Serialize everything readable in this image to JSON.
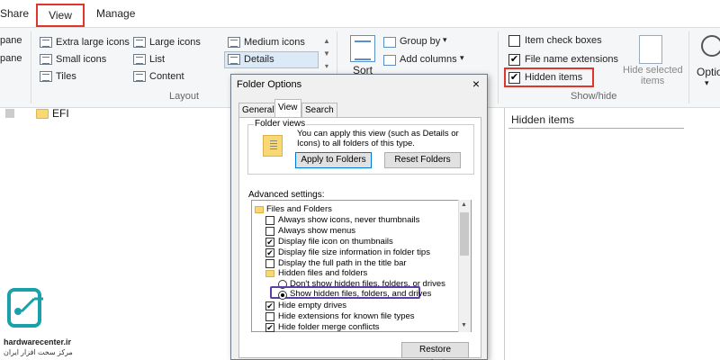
{
  "tabs": {
    "share": "Share",
    "view": "View",
    "manage": "Manage"
  },
  "ribbon": {
    "pane_1": "pane",
    "pane_2": "pane",
    "layout": {
      "extra_large_icons": "Extra large icons",
      "large_icons": "Large icons",
      "medium_icons": "Medium icons",
      "small_icons": "Small icons",
      "list": "List",
      "details": "Details",
      "tiles": "Tiles",
      "content": "Content",
      "group_label": "Layout"
    },
    "current_view": {
      "sort": "Sort",
      "group_by": "Group by",
      "add_columns": "Add columns"
    },
    "show_hide": {
      "item_check_boxes": "Item check boxes",
      "file_name_extensions": "File name extensions",
      "hidden_items": "Hidden items",
      "hide_selected_1": "Hide selected",
      "hide_selected_2": "items",
      "group_label": "Show/hide"
    },
    "options": "Optio"
  },
  "file_area": {
    "file_name": "EFI",
    "preview_title": "Hidden items"
  },
  "logo": {
    "name": "hardwarecenter.ir",
    "tagline": "مرکز سخت افزار ایران"
  },
  "dialog": {
    "title": "Folder Options",
    "close": "×",
    "tabs": [
      "General",
      "View",
      "Search"
    ],
    "folder_views_label": "Folder views",
    "folder_views_text": "You can apply this view (such as Details or Icons) to all folders of this type.",
    "apply_button": "Apply to Folders",
    "reset_button": "Reset Folders",
    "advanced_label": "Advanced settings:",
    "advanced_items": [
      "Files and Folders",
      "Always show icons, never thumbnails",
      "Always show menus",
      "Display file icon on thumbnails",
      "Display file size information in folder tips",
      "Display the full path in the title bar",
      "Hidden files and folders",
      "Don't show hidden files, folders, or drives",
      "Show hidden files, folders, and drives",
      "Hide empty drives",
      "Hide extensions for known file types",
      "Hide folder merge conflicts"
    ],
    "restore_button": "Restore Defaults"
  },
  "colors": {
    "red_highlight": "#e0352b",
    "purple_highlight": "#5a3fa8",
    "folder_yellow": "#f8d775"
  }
}
